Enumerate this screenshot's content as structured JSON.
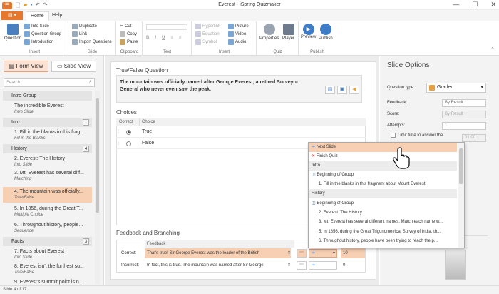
{
  "window": {
    "title": "Everest - iSpring Quizmaker"
  },
  "ribbon_tabs": [
    "Home",
    "Help"
  ],
  "ribbon": {
    "insert": {
      "question": "Question",
      "info_slide": "Info Slide",
      "question_group": "Question Group",
      "introduction": "Introduction",
      "label": "Insert"
    },
    "slide": {
      "duplicate": "Duplicate",
      "link": "Link",
      "import": "Import Questions",
      "label": "Slide"
    },
    "clipboard": {
      "cut": "Cut",
      "copy": "Copy",
      "paste": "Paste",
      "label": "Clipboard"
    },
    "text": {
      "label": "Text",
      "b": "B",
      "i": "I",
      "u": "U"
    },
    "insert2": {
      "hyperlink": "Hyperlink",
      "equation": "Equation",
      "symbol": "Symbol",
      "picture": "Picture",
      "video": "Video",
      "audio": "Audio",
      "label": "Insert"
    },
    "quiz": {
      "properties": "Properties",
      "player": "Player",
      "label": "Quiz"
    },
    "publish": {
      "preview": "Preview",
      "publish": "Publish",
      "label": "Publish"
    }
  },
  "left": {
    "form_view": "Form View",
    "slide_view": "Slide View",
    "search_placeholder": "Search",
    "groups": [
      {
        "name": "Intro Group",
        "count": "",
        "slides": [
          {
            "title": "The incredible Everest",
            "type": "Intro Slide"
          }
        ]
      },
      {
        "name": "Intro",
        "count": "1",
        "slides": [
          {
            "title": "1. Fill in the blanks in this frag...",
            "type": "Fill in the Blanks"
          }
        ]
      },
      {
        "name": "History",
        "count": "4",
        "slides": [
          {
            "title": "2. Everest: The History",
            "type": "Info Slide"
          },
          {
            "title": "3. Mt. Everest has several diff...",
            "type": "Matching"
          },
          {
            "title": "4. The mountain was officially...",
            "type": "True/False"
          },
          {
            "title": "5. In 1856, during the Great T...",
            "type": "Multiple Choice"
          },
          {
            "title": "6. Throughout history, people...",
            "type": "Sequence"
          }
        ]
      },
      {
        "name": "Facts",
        "count": "3",
        "slides": [
          {
            "title": "7. Facts about Everest",
            "type": "Info Slide"
          },
          {
            "title": "8. Everest isn't the furthest su...",
            "type": "True/False"
          },
          {
            "title": "9. Everest's summit point is n...",
            "type": ""
          }
        ]
      }
    ]
  },
  "status": "Slide 4 of 17",
  "main": {
    "question_type_title": "True/False Question",
    "question_text": "The mountain was officially named after George Everest, a retired Surveyor General who never even saw the peak.",
    "choices_title": "Choices",
    "choices_header": {
      "correct": "Correct",
      "choice": "Choice"
    },
    "choices": [
      {
        "text": "True",
        "correct": true
      },
      {
        "text": "False",
        "correct": false
      }
    ],
    "feedback_title": "Feedback and Branching",
    "feedback_header": "Feedback",
    "feedback_rows": [
      {
        "label": "Correct:",
        "text": "That's true! Sir George Everest was the leader of the British",
        "points": "10"
      },
      {
        "label": "Incorrect:",
        "text": "In fact, this is true. The mountain was named after Sir George",
        "points": "0"
      }
    ]
  },
  "options": {
    "title": "Slide Options",
    "question_type_label": "Question type:",
    "question_type_value": "Graded",
    "feedback_label": "Feedback:",
    "feedback_value": "By Result",
    "score_label": "Score:",
    "score_value": "By Result",
    "attempts_label": "Attempts:",
    "attempts_value": "1",
    "limit_label": "Limit time to answer the",
    "limit_value": "01:00"
  },
  "dropdown": {
    "items": [
      {
        "text": "Next Slide",
        "kind": "next"
      },
      {
        "text": "Finish Quiz",
        "kind": "finish"
      },
      {
        "text": "Intro",
        "kind": "head"
      },
      {
        "text": "Beginning of Group",
        "kind": "group"
      },
      {
        "text": "1. Fill in the blanks in this fragment about Mount Everest:",
        "kind": "l2"
      },
      {
        "text": "History",
        "kind": "head"
      },
      {
        "text": "Beginning of Group",
        "kind": "group"
      },
      {
        "text": "2. Everest: The History",
        "kind": "l2"
      },
      {
        "text": "3. Mt. Everest has several different names. Match each name w...",
        "kind": "l2"
      },
      {
        "text": "5. In 1856, during the Great Trigonometrical Survey of India, th...",
        "kind": "l2"
      },
      {
        "text": "6. Throughout history, people have been trying to reach the p...",
        "kind": "l2"
      }
    ]
  },
  "colors": {
    "accent": "#e8772e",
    "selected": "#f7cfb3",
    "blue": "#3e7cc6"
  }
}
